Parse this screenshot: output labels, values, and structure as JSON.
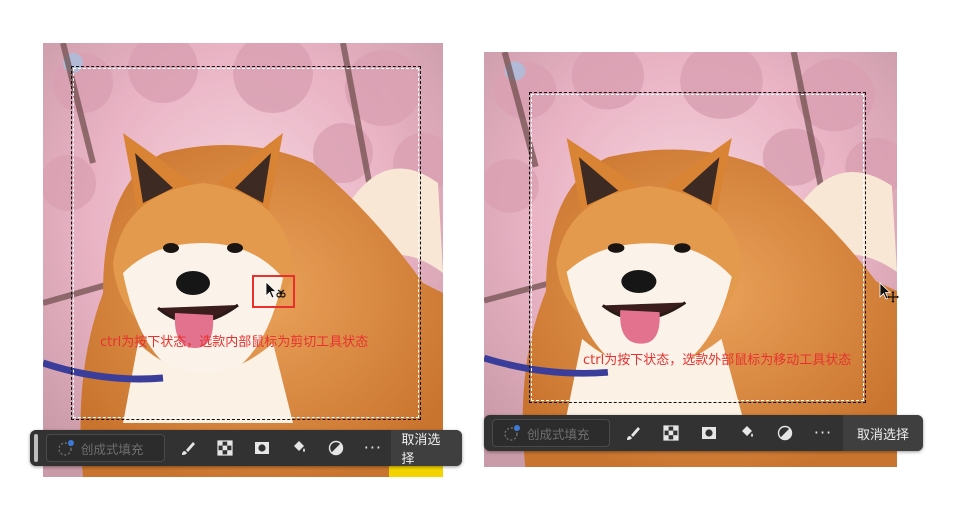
{
  "left_panel": {
    "annotation": "ctrl为按下状态，选款内部鼠标为剪切工具状态"
  },
  "right_panel": {
    "annotation": "ctrl为按下状态，选款外部鼠标为移动工具状态"
  },
  "toolbar": {
    "generative_fill_label": "创成式填充",
    "more_label": "···",
    "cancel_label": "取消选择",
    "icons": [
      "generative-fill-icon",
      "brush-icon",
      "checkerboard-icon",
      "mask-icon",
      "paint-bucket-icon",
      "adjustment-icon",
      "more-icon"
    ]
  },
  "colors": {
    "annotation_red": "#e8312f",
    "toolbar_bg": "#323232",
    "cancel_bg": "#3f3f3f"
  }
}
